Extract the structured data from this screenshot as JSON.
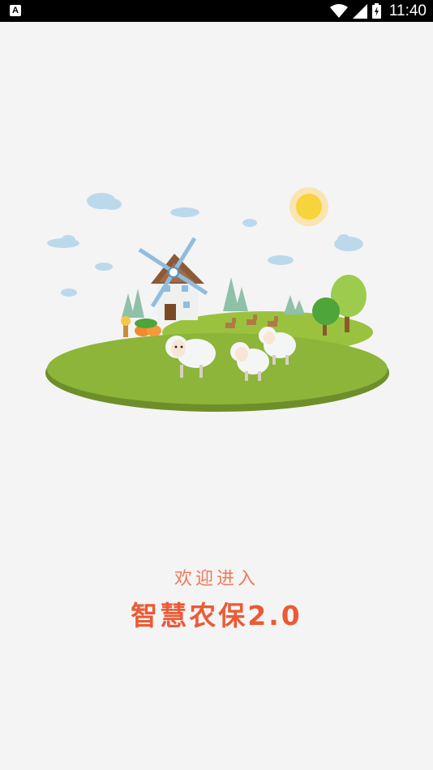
{
  "status_bar": {
    "app_icon_letter": "A",
    "time": "11:40",
    "icons": [
      "wifi-icon",
      "cell-signal-icon",
      "battery-icon"
    ]
  },
  "splash": {
    "illustration": "farm-scene-illustration",
    "welcome_text": "欢迎进入",
    "app_name": "智慧农保2.0"
  },
  "colors": {
    "background": "#f4f4f4",
    "welcome_text": "#f07a5a",
    "app_name": "#ec5a35",
    "grass": "#8db53a",
    "sun": "#f7d33c"
  }
}
